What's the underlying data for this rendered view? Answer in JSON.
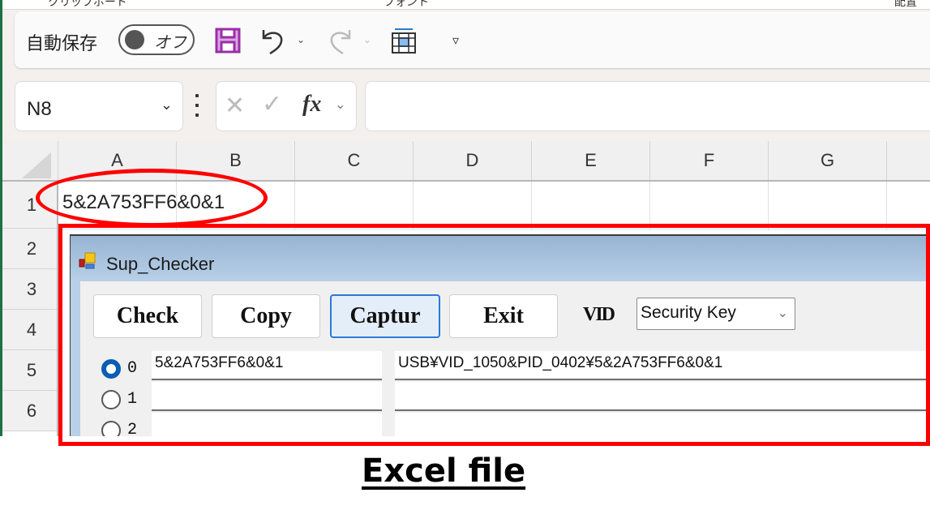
{
  "excel": {
    "ribbon_fragments": [
      "クリップボード",
      "フォント",
      "配置"
    ],
    "quick_access": {
      "autosave_label": "自動保存",
      "autosave_toggle_state": "オフ",
      "icons": [
        "save-icon",
        "undo-icon",
        "redo-icon",
        "grid-select-icon",
        "customize-qat-icon"
      ]
    },
    "formula_bar": {
      "name_box": "N8",
      "fx_label": "fx",
      "formula_value": ""
    },
    "columns": [
      "A",
      "B",
      "C",
      "D",
      "E",
      "F",
      "G"
    ],
    "rows": [
      "1",
      "2",
      "3",
      "4",
      "5",
      "6"
    ],
    "cells": {
      "A1": "5&2A753FF6&0&1"
    }
  },
  "form": {
    "title": "Sup_Checker",
    "buttons": {
      "check": "Check",
      "copy": "Copy",
      "capture": "Captur",
      "exit": "Exit"
    },
    "vid_label": "VID",
    "vid_selected": "Security Key",
    "rows": [
      {
        "radio_label": "0",
        "checked": true,
        "serial": "5&2A753FF6&0&1",
        "device_path": "USB¥VID_1050&PID_0402¥5&2A753FF6&0&1"
      },
      {
        "radio_label": "1",
        "checked": false,
        "serial": "",
        "device_path": ""
      },
      {
        "radio_label": "2",
        "checked": false,
        "serial": "",
        "device_path": ""
      }
    ]
  },
  "annotation": {
    "caption": "Excel file",
    "highlight_color": "#ff0000"
  }
}
